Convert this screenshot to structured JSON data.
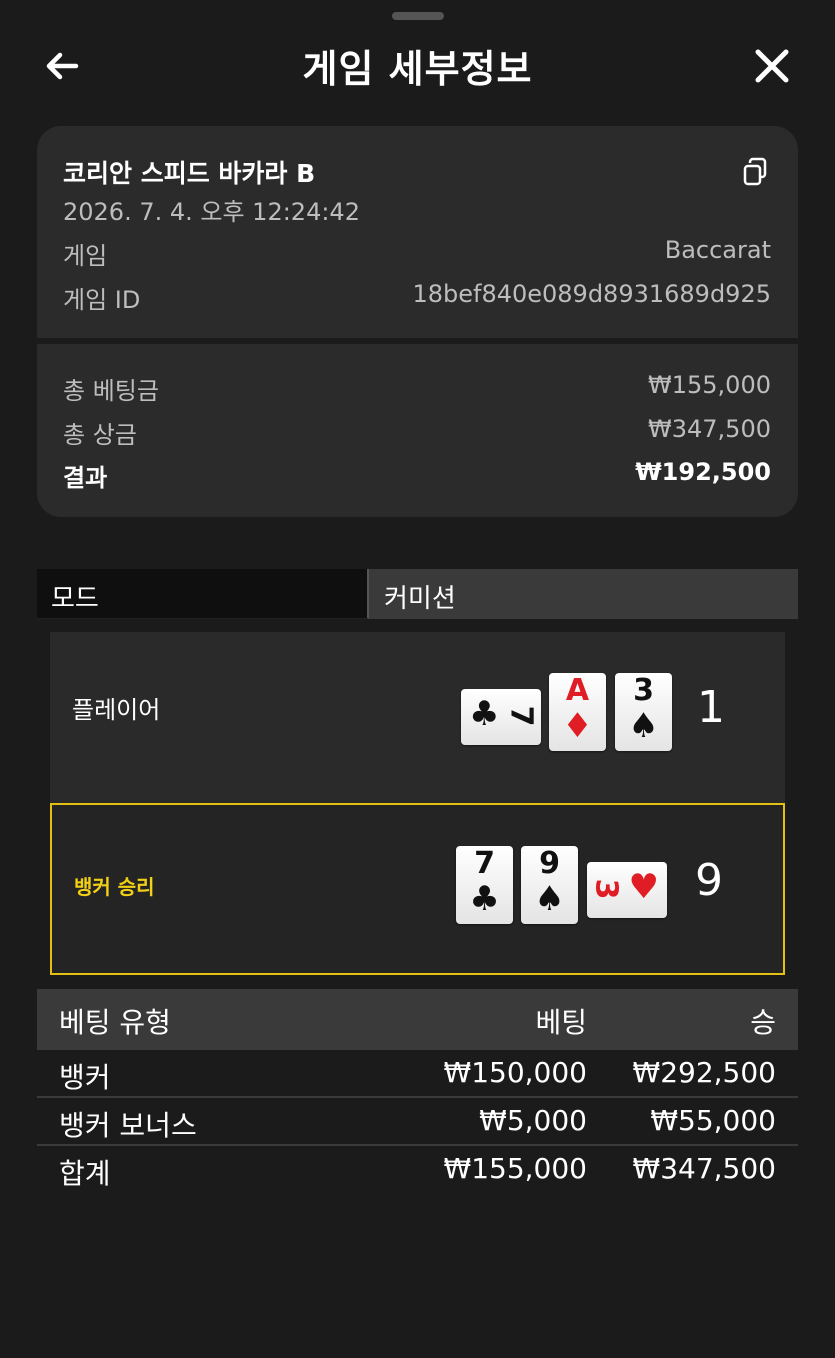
{
  "header": {
    "title": "게임 세부정보",
    "back_icon": "arrow-left-icon",
    "close_icon": "close-icon"
  },
  "summary": {
    "game_name": "코리안 스피드 바카라 B",
    "datetime": "2026. 7. 4. 오후 12:24:42",
    "copy_icon": "copy-icon",
    "rows": [
      {
        "label": "게임",
        "value": "Baccarat"
      },
      {
        "label": "게임 ID",
        "value": "18bef840e089d8931689d925"
      }
    ],
    "totals": [
      {
        "label": "총 베팅금",
        "value": "₩155,000"
      },
      {
        "label": "총 상금",
        "value": "₩347,500"
      },
      {
        "label": "결과",
        "value": "₩192,500"
      }
    ]
  },
  "tabs": {
    "mode_label": "모드",
    "value_label": "커미션"
  },
  "hands": {
    "player": {
      "label": "플레이어",
      "score": "1",
      "cards": [
        {
          "rank": "7",
          "suit": "♣",
          "color": "#111111"
        },
        {
          "rank": "A",
          "suit": "♦",
          "color": "#e01c24"
        },
        {
          "rank": "3",
          "suit": "♠",
          "color": "#111111"
        }
      ]
    },
    "banker": {
      "label": "뱅커 승리",
      "score": "9",
      "cards": [
        {
          "rank": "7",
          "suit": "♣",
          "color": "#111111"
        },
        {
          "rank": "9",
          "suit": "♠",
          "color": "#111111"
        },
        {
          "rank": "3",
          "suit": "♥",
          "color": "#e01c24"
        }
      ]
    }
  },
  "bets": {
    "headers": [
      "베팅 유형",
      "베팅",
      "승"
    ],
    "rows": [
      {
        "type": "뱅커",
        "bet": "₩150,000",
        "win": "₩292,500"
      },
      {
        "type": "뱅커 보너스",
        "bet": "₩5,000",
        "win": "₩55,000"
      },
      {
        "type": "합계",
        "bet": "₩155,000",
        "win": "₩347,500"
      }
    ]
  },
  "colors": {
    "background": "#1b1b1b",
    "card_panel": "#2b2b2b",
    "winner_accent": "#e3c012"
  }
}
